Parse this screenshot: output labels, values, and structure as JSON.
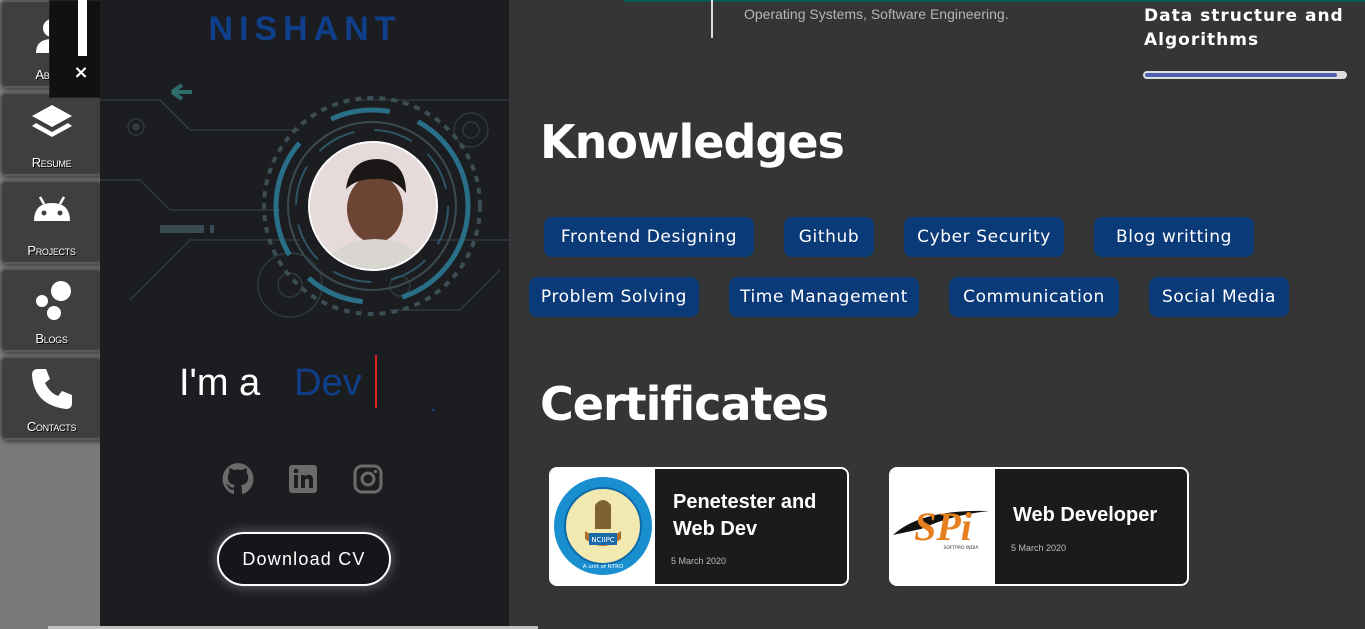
{
  "nav": {
    "items": [
      {
        "label": "About",
        "icon": "person-icon"
      },
      {
        "label": "Resume",
        "icon": "layers-icon"
      },
      {
        "label": "Projects",
        "icon": "android-icon"
      },
      {
        "label": "Blogs",
        "icon": "bubbles-icon"
      },
      {
        "label": "Contacts",
        "icon": "phone-icon"
      }
    ],
    "close_symbol": "×"
  },
  "profile": {
    "brand": "NISHANT",
    "typing_prefix": "I'm a",
    "typing_role": "Dev",
    "social": [
      "github-icon",
      "linkedin-icon",
      "instagram-icon"
    ],
    "download_label": "Download CV"
  },
  "education": {
    "text": "Operating Systems, Software Engineering."
  },
  "skill": {
    "title": "Data structure and Algorithms",
    "progress": 0.96
  },
  "knowledges": {
    "heading": "Knowledges",
    "tags": [
      "Frontend Designing",
      "Github",
      "Cyber Security",
      "Blog writting",
      "Problem Solving",
      "Time Management",
      "Communication",
      "Social Media"
    ]
  },
  "certificates": {
    "heading": "Certificates",
    "items": [
      {
        "title": "Penetester and Web Dev",
        "date": "5 March 2020",
        "logo": "NCIIPC seal",
        "seal_text": "National Critical Information Infrastructure Protection Centre",
        "seal_abbr": "NCIIPC",
        "seal_sub": "A unit of NTRO"
      },
      {
        "title": "Web Developer",
        "date": "5 March 2020",
        "logo": "SPi logo",
        "logo_text": "SPi",
        "logo_sub": "SOFTPRO INDIA"
      }
    ]
  },
  "colors": {
    "accent_blue": "#0b3a78",
    "brand_blue": "#0f3f8a",
    "panel_dark": "#1c1d21",
    "main_bg": "#353535"
  }
}
